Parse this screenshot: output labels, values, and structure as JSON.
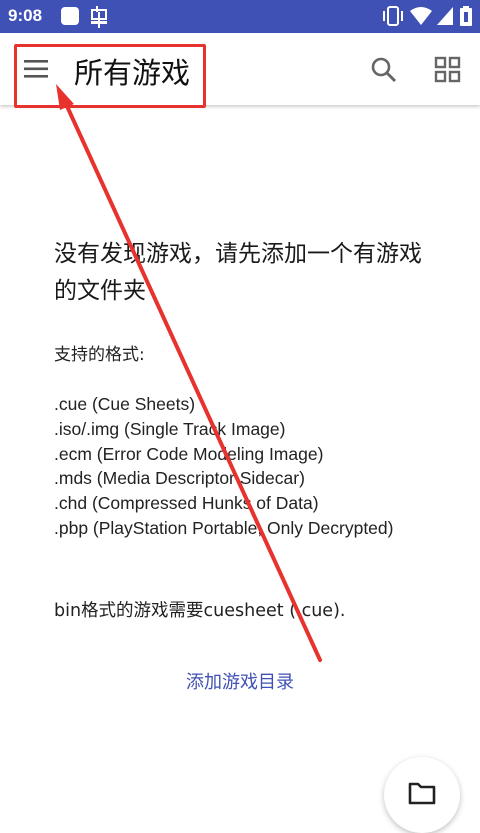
{
  "status_bar": {
    "time": "9:08",
    "icons": [
      "sim-card-icon",
      "bug-icon",
      "vibrate-icon",
      "wifi-icon",
      "signal-icon",
      "battery-icon"
    ]
  },
  "app_bar": {
    "title": "所有游戏",
    "menu_icon": "hamburger-menu-icon",
    "search_icon": "search-icon",
    "grid_icon": "grid-view-icon"
  },
  "main": {
    "headline": "没有发现游戏，请先添加一个有游戏的文件夹",
    "formats_label": "支持的格式:",
    "formats": [
      ".cue (Cue Sheets)",
      ".iso/.img (Single Track Image)",
      ".ecm (Error Code Modeling Image)",
      ".mds (Media Descriptor Sidecar)",
      ".chd (Compressed Hunks of Data)",
      ".pbp (PlayStation Portable, Only Decrypted)"
    ],
    "bin_note": "bin格式的游戏需要cuesheet (.cue).",
    "add_link": "添加游戏目录"
  },
  "fab": {
    "icon": "folder-icon"
  },
  "colors": {
    "accent": "#3f51b5",
    "annotation": "#e8322d"
  }
}
